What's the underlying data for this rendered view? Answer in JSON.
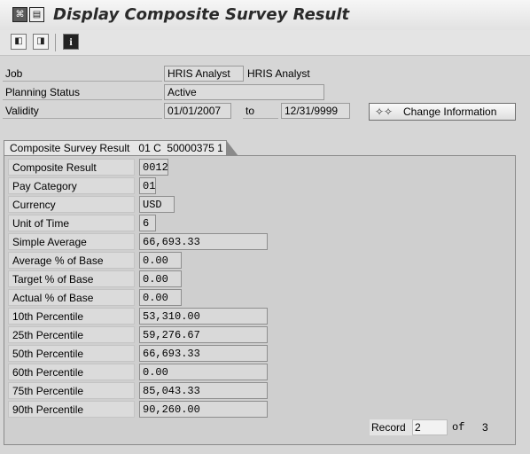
{
  "title": "Display Composite Survey Result",
  "header": {
    "job_label": "Job",
    "job_code": "HRIS Analyst",
    "job_text": "HRIS Analyst",
    "planning_status_label": "Planning Status",
    "planning_status_value": "Active",
    "validity_label": "Validity",
    "validity_from": "01/01/2007",
    "to_label": "to",
    "validity_to": "12/31/9999",
    "change_info_button": "Change Information"
  },
  "group": {
    "title": "Composite Survey Result   01 C  50000375 1",
    "rows": [
      {
        "label": "Composite Result",
        "value": "0012"
      },
      {
        "label": "Pay Category",
        "value": "01"
      },
      {
        "label": "Currency",
        "value": "USD"
      },
      {
        "label": "Unit of Time",
        "value": "6"
      },
      {
        "label": "Simple Average",
        "value": "66,693.33"
      },
      {
        "label": "Average % of Base",
        "value": "0.00"
      },
      {
        "label": "Target % of Base",
        "value": "0.00"
      },
      {
        "label": "Actual % of Base",
        "value": "0.00"
      },
      {
        "label": "10th Percentile",
        "value": "53,310.00"
      },
      {
        "label": "25th Percentile",
        "value": "59,276.67"
      },
      {
        "label": "50th Percentile",
        "value": "66,693.33"
      },
      {
        "label": "60th Percentile",
        "value": "0.00"
      },
      {
        "label": "75th Percentile",
        "value": "85,043.33"
      },
      {
        "label": "90th Percentile",
        "value": "90,260.00"
      }
    ]
  },
  "record": {
    "label": "Record",
    "current": "2",
    "of_label": "of",
    "total": "3"
  }
}
